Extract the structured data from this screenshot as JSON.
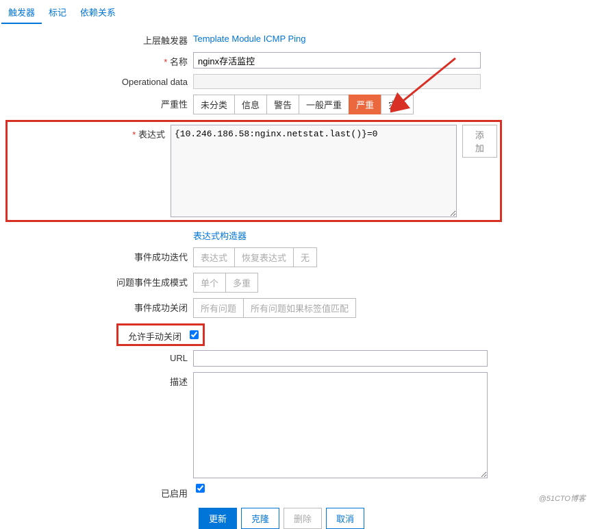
{
  "tabs": {
    "trigger": "触发器",
    "mark": "标记",
    "depend": "依赖关系"
  },
  "labels": {
    "parent": "上层触发器",
    "name_req": "*",
    "name": "名称",
    "opdata": "Operational data",
    "severity": "严重性",
    "expr_req": "*",
    "expr": "表达式",
    "iter": "事件成功迭代",
    "mode": "问题事件生成模式",
    "close": "事件成功关闭",
    "allow": "允许手动关闭",
    "url": "URL",
    "desc": "描述",
    "enabled": "已启用"
  },
  "values": {
    "parent_link": "Template Module ICMP Ping",
    "name": "nginx存活监控",
    "expr": "{10.246.186.58:nginx.netstat.last()}=0",
    "expr_builder": "表达式构造器",
    "add": "添加"
  },
  "severity": {
    "s0": "未分类",
    "s1": "信息",
    "s2": "警告",
    "s3": "一般严重",
    "s4": "严重",
    "s5": "灾难"
  },
  "iter": {
    "b0": "表达式",
    "b1": "恢复表达式",
    "b2": "无"
  },
  "mode": {
    "b0": "单个",
    "b1": "多重"
  },
  "close": {
    "b0": "所有问题",
    "b1": "所有问题如果标签值匹配"
  },
  "actions": {
    "update": "更新",
    "clone": "克隆",
    "delete": "删除",
    "cancel": "取消"
  },
  "watermark": "@51CTO博客"
}
